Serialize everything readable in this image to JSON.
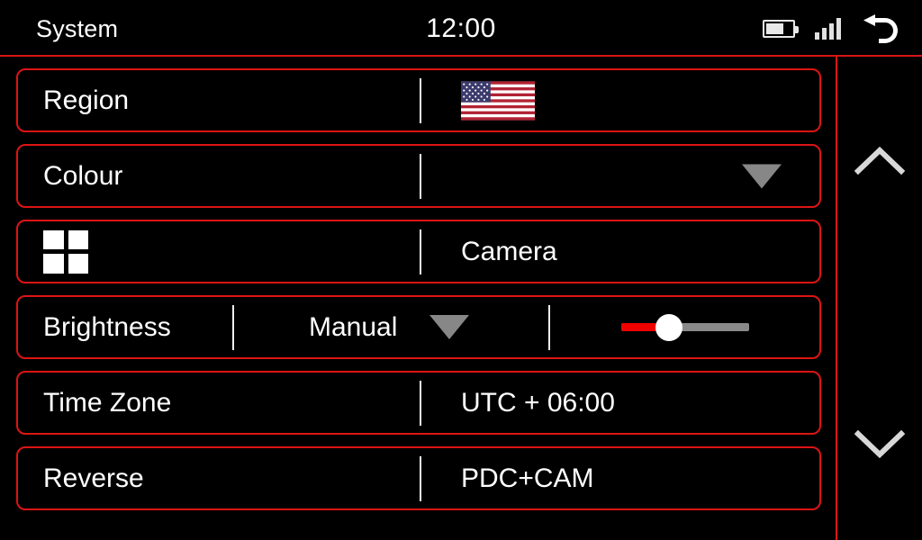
{
  "statusbar": {
    "title": "System",
    "clock": "12:00",
    "icons": {
      "battery": "battery-icon",
      "signal": "signal-bars-icon",
      "back": "back-arrow-icon"
    }
  },
  "colors": {
    "accent_red": "#dc1414",
    "slider_fill": "#f00000",
    "background": "#000000",
    "text": "#ffffff",
    "caret_grey": "#878787",
    "track_grey": "#8a8a8a"
  },
  "settings": {
    "rows": [
      {
        "id": "region",
        "label": "Region",
        "value": "",
        "value_type": "flag",
        "flag": "us-flag-icon"
      },
      {
        "id": "colour",
        "label": "Colour",
        "value": "",
        "value_type": "dropdown"
      },
      {
        "id": "camera",
        "label": "",
        "value": "Camera",
        "value_type": "text",
        "label_icon": "grid-2x2-icon"
      },
      {
        "id": "brightness",
        "label": "Brightness",
        "value": "Manual",
        "value_type": "dropdown-slider",
        "slider_percent": 38
      },
      {
        "id": "timezone",
        "label": "Time Zone",
        "value": "UTC + 06:00",
        "value_type": "text"
      },
      {
        "id": "reverse",
        "label": "Reverse",
        "value": "PDC+CAM",
        "value_type": "text"
      }
    ]
  },
  "scrollrail": {
    "up": "chevron-up-icon",
    "down": "chevron-down-icon"
  }
}
